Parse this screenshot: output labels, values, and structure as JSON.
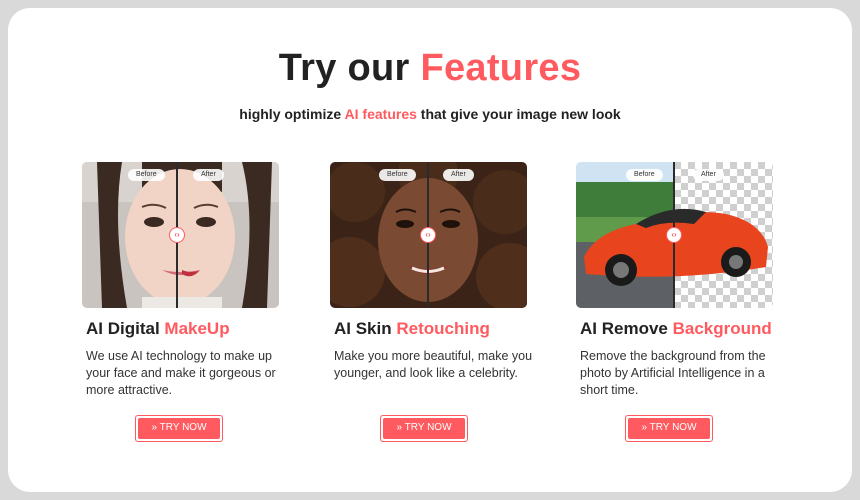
{
  "header": {
    "title_plain": "Try our ",
    "title_highlight": "Features",
    "subtitle_pre": "highly optimize ",
    "subtitle_highlight": "AI features",
    "subtitle_post": " that give your image new look"
  },
  "accent_color": "#ff5a5f",
  "cards": [
    {
      "title_plain": "AI Digital ",
      "title_highlight": "MakeUp",
      "description": "We use AI technology to make up your face and make it gorgeous or more attractive.",
      "before_label": "Before",
      "after_label": "After",
      "button_icon": "»",
      "button_label": "TRY NOW"
    },
    {
      "title_plain": "AI Skin ",
      "title_highlight": "Retouching",
      "description": "Make you more beautiful, make you younger, and look like a celebrity.",
      "before_label": "Before",
      "after_label": "After",
      "button_icon": "»",
      "button_label": "TRY NOW"
    },
    {
      "title_plain": "AI Remove ",
      "title_highlight": "Background",
      "description": "Remove the background from the photo by Artificial Intelligence in a short time.",
      "before_label": "Before",
      "after_label": "After",
      "button_icon": "»",
      "button_label": "TRY NOW"
    }
  ],
  "icons": {
    "compare_handle": "left-right-arrows-icon",
    "try_now": "double-chevron-right-icon"
  }
}
